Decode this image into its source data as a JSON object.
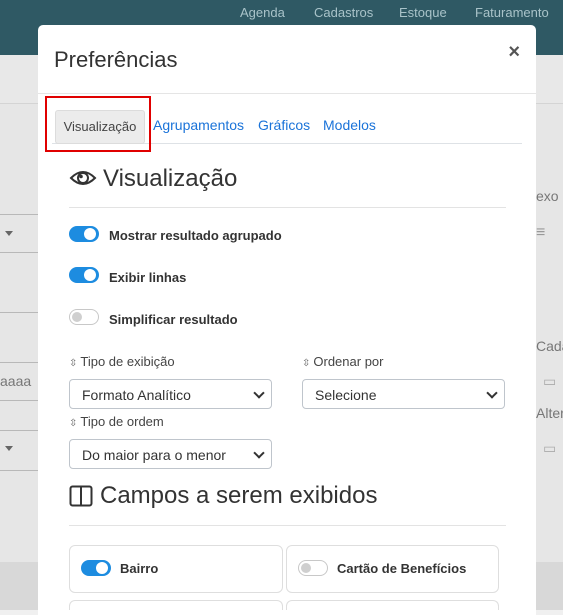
{
  "topnav": {
    "items": [
      "Agenda",
      "Cadastros",
      "Estoque",
      "Faturamento"
    ]
  },
  "background": {
    "left_placeholder": "aaaa",
    "right_labels": [
      "exo",
      "Cadas",
      "Altera"
    ]
  },
  "modal": {
    "title": "Preferências",
    "close_symbol": "×",
    "tabs": [
      {
        "label": "Visualização",
        "active": true
      },
      {
        "label": "Agrupamentos",
        "active": false
      },
      {
        "label": "Gráficos",
        "active": false
      },
      {
        "label": "Modelos",
        "active": false
      }
    ],
    "visualizacao": {
      "title": "Visualização",
      "options": [
        {
          "label": "Mostrar resultado agrupado",
          "enabled": true
        },
        {
          "label": "Exibir linhas",
          "enabled": true
        },
        {
          "label": "Simplificar resultado",
          "enabled": false
        }
      ],
      "tipo_exibicao": {
        "label": "Tipo de exibição",
        "value": "Formato Analítico"
      },
      "ordenar_por": {
        "label": "Ordenar por",
        "value": "Selecione"
      },
      "tipo_ordem": {
        "label": "Tipo de ordem",
        "value": "Do maior para o menor"
      }
    },
    "campos": {
      "title": "Campos a serem exibidos",
      "fields": [
        {
          "label": "Bairro",
          "enabled": true
        },
        {
          "label": "Cartão de Benefícios",
          "enabled": false
        }
      ]
    }
  },
  "colors": {
    "accent": "#1d8ce0",
    "header": "#2f5964",
    "highlight": "#e00000"
  }
}
